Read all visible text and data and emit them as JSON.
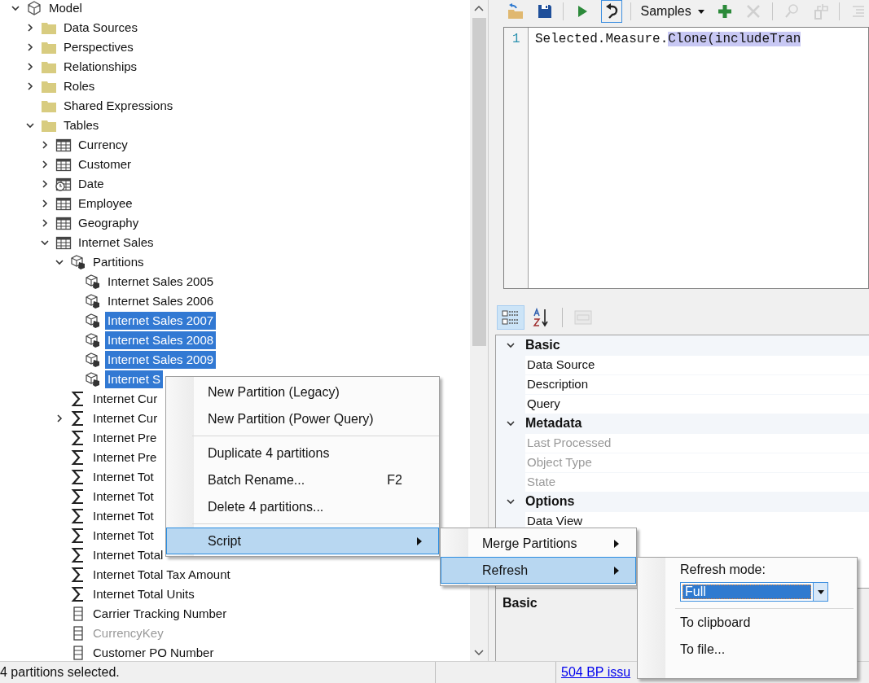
{
  "tree": [
    {
      "label": "Model",
      "kind": "model",
      "expanded": true,
      "selected": false,
      "disabled": false,
      "children": [
        {
          "label": "Data Sources",
          "kind": "folder",
          "expanded": false,
          "selected": false,
          "disabled": false
        },
        {
          "label": "Perspectives",
          "kind": "folder",
          "expanded": false,
          "selected": false,
          "disabled": false
        },
        {
          "label": "Relationships",
          "kind": "folder",
          "expanded": false,
          "selected": false,
          "disabled": false
        },
        {
          "label": "Roles",
          "kind": "folder",
          "expanded": false,
          "selected": false,
          "disabled": false
        },
        {
          "label": "Shared Expressions",
          "kind": "folder",
          "selected": false,
          "disabled": false
        },
        {
          "label": "Tables",
          "kind": "folder",
          "expanded": true,
          "selected": false,
          "disabled": false,
          "children": [
            {
              "label": "Currency",
              "kind": "table",
              "expanded": false,
              "selected": false,
              "disabled": false
            },
            {
              "label": "Customer",
              "kind": "table",
              "expanded": false,
              "selected": false,
              "disabled": false
            },
            {
              "label": "Date",
              "kind": "date_table",
              "expanded": false,
              "selected": false,
              "disabled": false
            },
            {
              "label": "Employee",
              "kind": "table",
              "expanded": false,
              "selected": false,
              "disabled": false
            },
            {
              "label": "Geography",
              "kind": "table",
              "expanded": false,
              "selected": false,
              "disabled": false
            },
            {
              "label": "Internet Sales",
              "kind": "table",
              "expanded": true,
              "selected": false,
              "disabled": false,
              "children": [
                {
                  "label": "Partitions",
                  "kind": "partitions",
                  "expanded": true,
                  "selected": false,
                  "disabled": false,
                  "children": [
                    {
                      "label": "Internet Sales 2005",
                      "kind": "partition",
                      "selected": false,
                      "disabled": false
                    },
                    {
                      "label": "Internet Sales 2006",
                      "kind": "partition",
                      "selected": false,
                      "disabled": false
                    },
                    {
                      "label": "Internet Sales 2007",
                      "kind": "partition",
                      "selected": true,
                      "disabled": false
                    },
                    {
                      "label": "Internet Sales 2008",
                      "kind": "partition",
                      "selected": true,
                      "disabled": false
                    },
                    {
                      "label": "Internet Sales 2009",
                      "kind": "partition",
                      "selected": true,
                      "disabled": false
                    },
                    {
                      "label": "Internet S",
                      "kind": "partition",
                      "selected": true,
                      "disabled": false
                    }
                  ]
                },
                {
                  "label": "Internet Cur",
                  "kind": "measure",
                  "selected": false,
                  "disabled": false
                },
                {
                  "label": "Internet Cur",
                  "kind": "measure",
                  "expanded": false,
                  "selected": false,
                  "disabled": false
                },
                {
                  "label": "Internet Pre",
                  "kind": "measure",
                  "selected": false,
                  "disabled": false
                },
                {
                  "label": "Internet Pre",
                  "kind": "measure",
                  "selected": false,
                  "disabled": false
                },
                {
                  "label": "Internet Tot",
                  "kind": "measure",
                  "selected": false,
                  "disabled": false
                },
                {
                  "label": "Internet Tot",
                  "kind": "measure",
                  "selected": false,
                  "disabled": false
                },
                {
                  "label": "Internet Tot",
                  "kind": "measure",
                  "selected": false,
                  "disabled": false
                },
                {
                  "label": "Internet Tot",
                  "kind": "measure",
                  "selected": false,
                  "disabled": false
                },
                {
                  "label": "Internet Total",
                  "kind": "measure",
                  "selected": false,
                  "disabled": false
                },
                {
                  "label": "Internet Total Tax Amount",
                  "kind": "measure",
                  "selected": false,
                  "disabled": false
                },
                {
                  "label": "Internet Total Units",
                  "kind": "measure",
                  "selected": false,
                  "disabled": false
                },
                {
                  "label": "Carrier Tracking Number",
                  "kind": "column",
                  "selected": false,
                  "disabled": false
                },
                {
                  "label": "CurrencyKey",
                  "kind": "column",
                  "selected": false,
                  "disabled": true
                },
                {
                  "label": "Customer PO Number",
                  "kind": "column",
                  "selected": false,
                  "disabled": false
                }
              ]
            }
          ]
        }
      ]
    }
  ],
  "toolbar": {
    "samples": "Samples",
    "buttons": [
      {
        "kind": "open",
        "disabled": false,
        "selected": false
      },
      {
        "kind": "save",
        "disabled": false,
        "selected": false
      },
      {
        "kind": "separator"
      },
      {
        "kind": "run",
        "disabled": false,
        "selected": false
      },
      {
        "kind": "undo",
        "disabled": false,
        "selected": true
      },
      {
        "kind": "separator"
      },
      {
        "kind": "samples"
      },
      {
        "kind": "add",
        "disabled": false,
        "selected": false
      },
      {
        "kind": "delete",
        "disabled": true,
        "selected": false
      },
      {
        "kind": "separator"
      },
      {
        "kind": "find",
        "disabled": true,
        "selected": false
      },
      {
        "kind": "replace",
        "disabled": true,
        "selected": false
      },
      {
        "kind": "separator"
      },
      {
        "kind": "indent",
        "disabled": true,
        "selected": false
      }
    ]
  },
  "editor": {
    "lines": [
      {
        "number": "1",
        "text": "Selected.Measure.",
        "highlighted": "Clone(includeTran"
      }
    ]
  },
  "property_toolbar": [
    {
      "kind": "categorized",
      "selected": true,
      "disabled": false
    },
    {
      "kind": "alphabetical",
      "selected": false,
      "disabled": false
    },
    {
      "kind": "separator"
    },
    {
      "kind": "pages",
      "selected": false,
      "disabled": true
    }
  ],
  "properties": [
    {
      "category": "Basic",
      "rows": [
        {
          "label": "Data Source",
          "disabled": false
        },
        {
          "label": "Description",
          "disabled": false
        },
        {
          "label": "Query",
          "disabled": false
        }
      ]
    },
    {
      "category": "Metadata",
      "rows": [
        {
          "label": "Last Processed",
          "disabled": true
        },
        {
          "label": "Object Type",
          "disabled": true
        },
        {
          "label": "State",
          "disabled": true
        }
      ]
    },
    {
      "category": "Options",
      "rows": [
        {
          "label": "Data View",
          "disabled": false
        }
      ]
    }
  ],
  "description_title": "Basic",
  "context_menu": {
    "items": [
      {
        "kind": "item",
        "label": "New Partition (Legacy)",
        "selected": false
      },
      {
        "kind": "item",
        "label": "New Partition (Power Query)",
        "selected": false
      },
      {
        "kind": "separator"
      },
      {
        "kind": "item",
        "label": "Duplicate 4 partitions",
        "selected": false
      },
      {
        "kind": "item",
        "label": "Batch Rename...",
        "shortcut": "F2",
        "selected": false
      },
      {
        "kind": "item",
        "label": "Delete 4 partitions...",
        "selected": false
      },
      {
        "kind": "separator"
      },
      {
        "kind": "submenu",
        "label": "Script",
        "selected": true
      }
    ]
  },
  "script_menu": {
    "items": [
      {
        "kind": "submenu",
        "label": "Merge Partitions",
        "selected": false
      },
      {
        "kind": "submenu",
        "label": "Refresh",
        "selected": true
      }
    ]
  },
  "refresh_menu": {
    "mode_label": "Refresh mode:",
    "mode_value": "Full",
    "items": [
      {
        "label": "To clipboard"
      },
      {
        "label": "To file..."
      }
    ]
  },
  "status_bar": {
    "message": "4 partitions selected.",
    "link": "504 BP issu"
  }
}
